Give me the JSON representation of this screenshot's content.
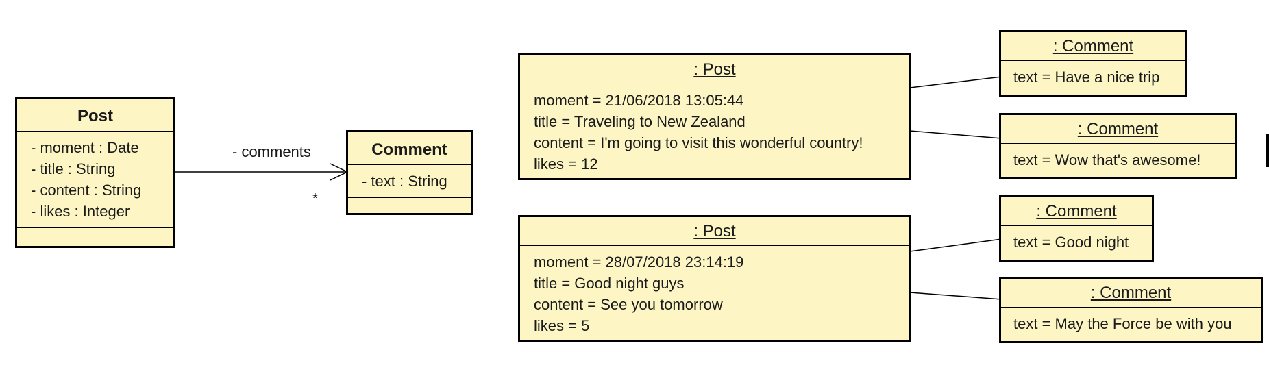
{
  "class_diagram": {
    "post_class": {
      "name": "Post",
      "attributes": [
        "- moment : Date",
        "- title : String",
        "- content : String",
        "- likes : Integer"
      ]
    },
    "comment_class": {
      "name": "Comment",
      "attributes": [
        "- text : String"
      ]
    },
    "association": {
      "role": "- comments",
      "multiplicity": "*"
    }
  },
  "object_diagram": {
    "posts": [
      {
        "header": ": Post",
        "attributes": [
          "moment = 21/06/2018 13:05:44",
          "title = Traveling to New Zealand",
          "content = I'm going to visit this wonderful country!",
          "likes = 12"
        ],
        "comments": [
          {
            "header": ": Comment",
            "text": "text = Have a nice trip"
          },
          {
            "header": ": Comment",
            "text": "text = Wow that's awesome!"
          }
        ]
      },
      {
        "header": ": Post",
        "attributes": [
          "moment = 28/07/2018 23:14:19",
          "title = Good night guys",
          "content = See you tomorrow",
          "likes = 5"
        ],
        "comments": [
          {
            "header": ": Comment",
            "text": "text = Good night"
          },
          {
            "header": ": Comment",
            "text": "text = May the Force be with you"
          }
        ]
      }
    ]
  },
  "colors": {
    "box_fill": "#fdf6c4",
    "border": "#000000",
    "text": "#1a1a1a"
  }
}
